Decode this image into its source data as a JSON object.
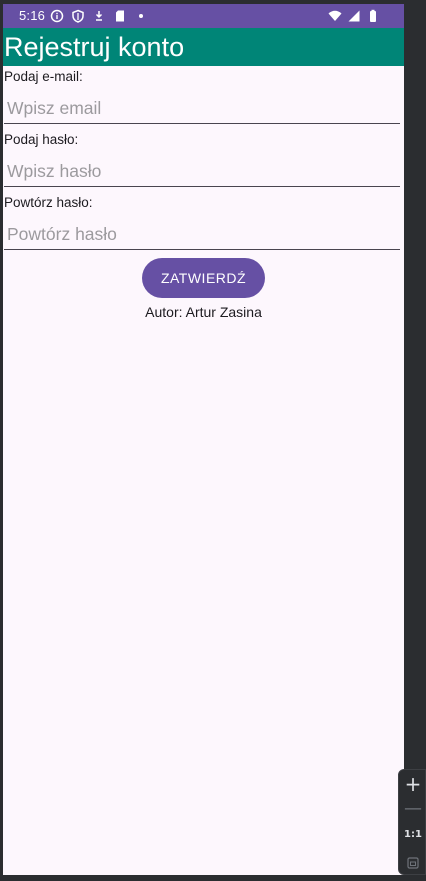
{
  "status_bar": {
    "time": "5:16",
    "left_icons": [
      "info-icon",
      "shield-icon",
      "download-icon",
      "sd-card-icon",
      "dot-icon"
    ],
    "right_icons": [
      "wifi-icon",
      "signal-icon",
      "battery-icon"
    ]
  },
  "app_bar": {
    "title": "Rejestruj konto"
  },
  "form": {
    "email_label": "Podaj e-mail:",
    "email_placeholder": "Wpisz email",
    "password_label": "Podaj hasło:",
    "password_placeholder": "Wpisz hasło",
    "repeat_label": "Powtórz hasło:",
    "repeat_placeholder": "Powtórz hasło",
    "submit_label": "ZATWIERDŹ",
    "author": "Autor: Artur Zasina"
  },
  "zoom_panel": {
    "zoom_in": "+",
    "zoom_out": "—",
    "actual_size": "1:1"
  },
  "colors": {
    "status_bar": "#6650a4",
    "app_bar": "#008577",
    "button": "#6650a4",
    "background": "#fdf7fd"
  }
}
